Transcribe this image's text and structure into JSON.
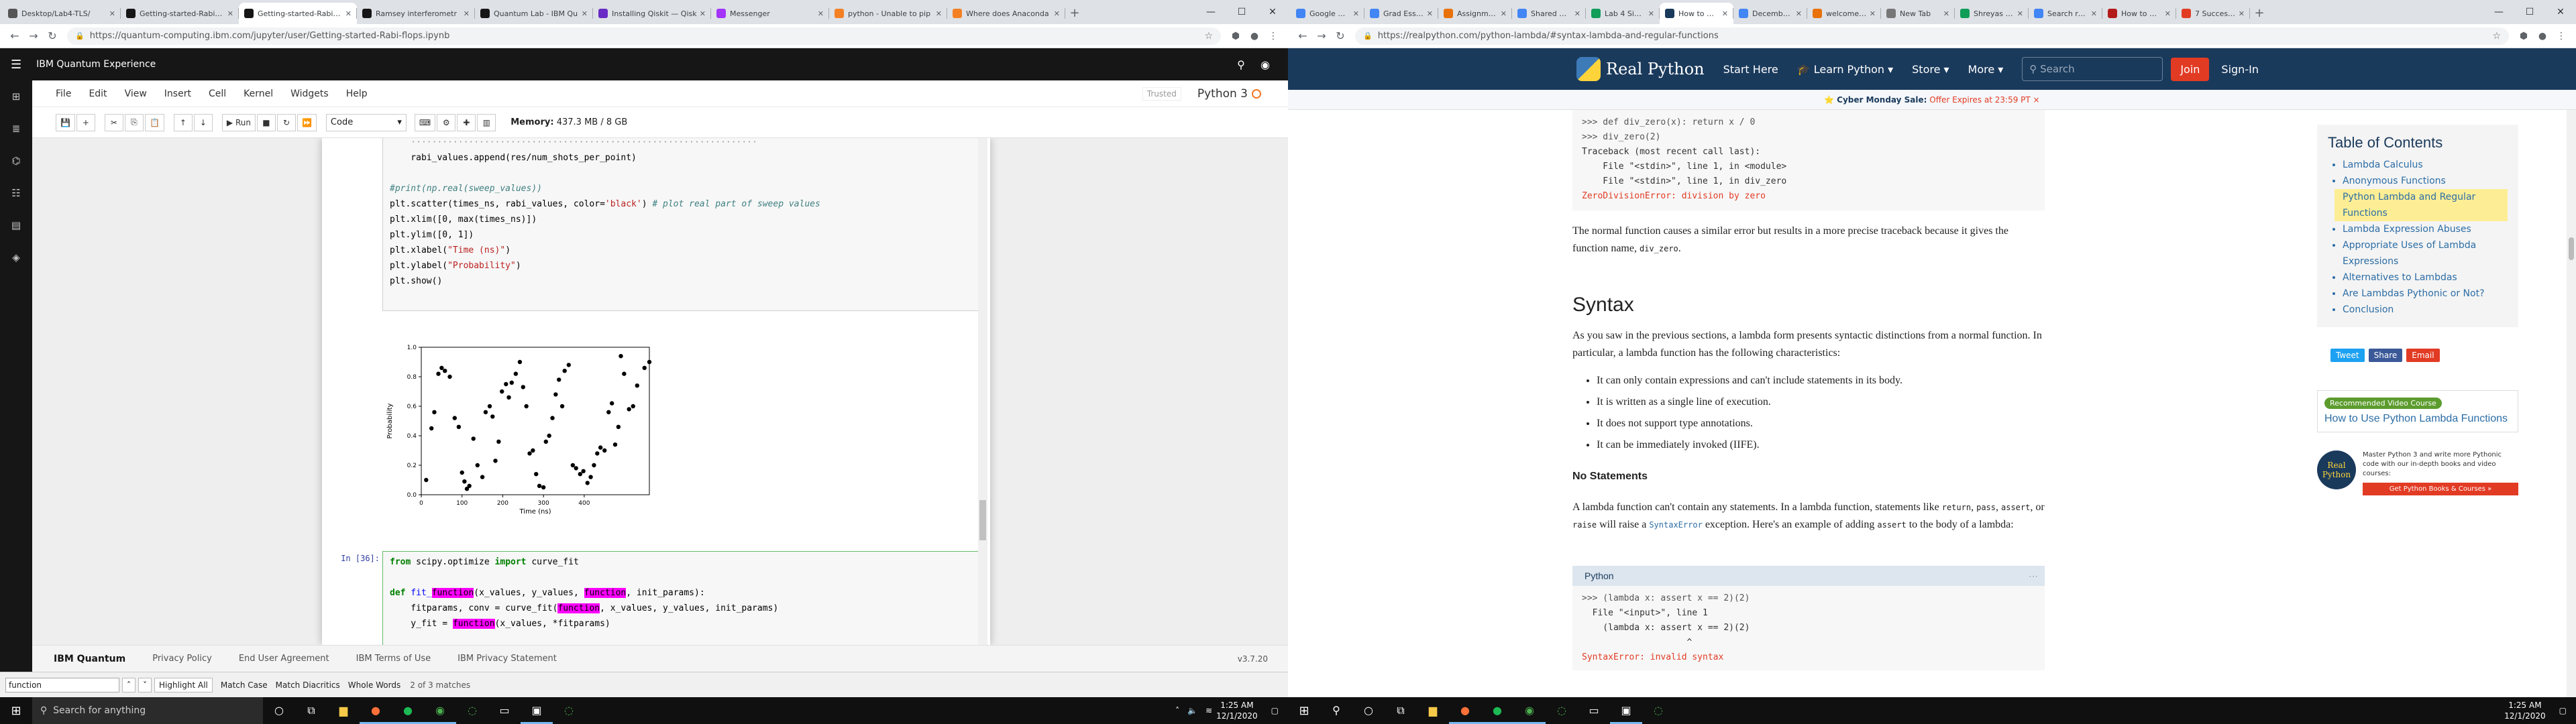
{
  "left_browser": {
    "tabs": [
      {
        "title": "Desktop/Lab4-TLS/",
        "fav_color": "#555555"
      },
      {
        "title": "Getting-started-Rabi-flo",
        "fav_color": "#161616"
      },
      {
        "title": "Getting-started-Rabi-flo",
        "fav_color": "#161616"
      },
      {
        "title": "Ramsey interferometr",
        "fav_color": "#161616"
      },
      {
        "title": "Quantum Lab - IBM Qu",
        "fav_color": "#161616"
      },
      {
        "title": "Installing Qiskit — Qisk",
        "fav_color": "#6929c4"
      },
      {
        "title": "Messenger",
        "fav_color": "#a334fa"
      },
      {
        "title": "python - Unable to pip",
        "fav_color": "#f48024"
      },
      {
        "title": "Where does Anaconda",
        "fav_color": "#f48024"
      }
    ],
    "url": "https://quantum-computing.ibm.com/jupyter/user/Getting-started-Rabi-flops.ipynb"
  },
  "ibm": {
    "brand": "IBM Quantum Experience",
    "menu": [
      "File",
      "Edit",
      "View",
      "Insert",
      "Cell",
      "Kernel",
      "Widgets",
      "Help"
    ],
    "trusted": "Trusted",
    "kernel": "Python 3",
    "toolbar": {
      "run": "Run",
      "cell_type": "Code",
      "memory_label": "Memory:",
      "memory_value": "437.3 MB / 8 GB"
    },
    "code1": {
      "line_prev": "    rabi_values.append(res/num_shots_per_point)",
      "comment": "#print(np.real(sweep_values))",
      "scatter_a": "plt.scatter(times_ns, rabi_values, color=",
      "scatter_b": "'black'",
      "scatter_c": ") ",
      "scatter_comment": "# plot real part of sweep values",
      "xlim": "plt.xlim([0, max(times_ns)])",
      "ylim": "plt.ylim([0, 1])",
      "xlabel_a": "plt.xlabel(",
      "xlabel_b": "\"Time (ns)\"",
      "xlabel_c": ")",
      "ylabel_a": "plt.ylabel(",
      "ylabel_b": "\"Probability\"",
      "ylabel_c": ")",
      "show": "plt.show()"
    },
    "code2": {
      "prompt": "In [36]:",
      "l1a": "from",
      "l1b": " scipy.optimize ",
      "l1c": "import",
      "l1d": " curve_fit",
      "l2a": "def",
      "l2b": " fit_",
      "l2c": "function",
      "l2d": "(x_values, y_values, ",
      "l2e": "function",
      "l2f": ", init_params):",
      "l3a": "    fitparams, conv = curve_fit(",
      "l3b": "function",
      "l3c": ", x_values, y_values, init_params)",
      "l4a": "    y_fit = ",
      "l4b": "function",
      "l4c": "(x_values, *fitparams)"
    },
    "footer": {
      "brand": "IBM Quantum",
      "links": [
        "Privacy Policy",
        "End User Agreement",
        "IBM Terms of Use",
        "IBM Privacy Statement"
      ],
      "version": "v3.7.20"
    },
    "find": {
      "query": "function",
      "highlight": "Highlight All",
      "match_case": "Match Case",
      "match_diacritics": "Match Diacritics",
      "whole_words": "Whole Words",
      "result": "2 of 3 matches"
    }
  },
  "chart_data": {
    "type": "scatter",
    "xlabel": "Time (ns)",
    "ylabel": "Probability",
    "xlim": [
      0,
      490
    ],
    "ylim": [
      0,
      1
    ],
    "xticks": [
      0,
      100,
      200,
      300,
      400
    ],
    "yticks": [
      0.0,
      0.2,
      0.4,
      0.6,
      0.8,
      1.0
    ],
    "points": [
      [
        12,
        0.1
      ],
      [
        25,
        0.45
      ],
      [
        32,
        0.56
      ],
      [
        42,
        0.82
      ],
      [
        50,
        0.86
      ],
      [
        58,
        0.84
      ],
      [
        70,
        0.8
      ],
      [
        82,
        0.52
      ],
      [
        92,
        0.46
      ],
      [
        100,
        0.15
      ],
      [
        106,
        0.09
      ],
      [
        112,
        0.04
      ],
      [
        118,
        0.06
      ],
      [
        128,
        0.38
      ],
      [
        138,
        0.2
      ],
      [
        150,
        0.12
      ],
      [
        158,
        0.56
      ],
      [
        168,
        0.6
      ],
      [
        175,
        0.53
      ],
      [
        182,
        0.23
      ],
      [
        190,
        0.36
      ],
      [
        198,
        0.7
      ],
      [
        208,
        0.75
      ],
      [
        215,
        0.66
      ],
      [
        222,
        0.76
      ],
      [
        232,
        0.82
      ],
      [
        242,
        0.9
      ],
      [
        250,
        0.73
      ],
      [
        258,
        0.6
      ],
      [
        266,
        0.28
      ],
      [
        274,
        0.3
      ],
      [
        282,
        0.14
      ],
      [
        290,
        0.06
      ],
      [
        300,
        0.05
      ],
      [
        306,
        0.36
      ],
      [
        314,
        0.4
      ],
      [
        322,
        0.52
      ],
      [
        330,
        0.68
      ],
      [
        338,
        0.78
      ],
      [
        346,
        0.6
      ],
      [
        352,
        0.84
      ],
      [
        362,
        0.88
      ],
      [
        372,
        0.2
      ],
      [
        380,
        0.18
      ],
      [
        390,
        0.14
      ],
      [
        398,
        0.16
      ],
      [
        408,
        0.08
      ],
      [
        416,
        0.12
      ],
      [
        424,
        0.2
      ],
      [
        432,
        0.28
      ],
      [
        440,
        0.32
      ],
      [
        450,
        0.3
      ],
      [
        460,
        0.56
      ],
      [
        468,
        0.62
      ],
      [
        476,
        0.34
      ],
      [
        484,
        0.46
      ],
      [
        490,
        0.94
      ],
      [
        498,
        0.82
      ],
      [
        510,
        0.58
      ],
      [
        520,
        0.6
      ],
      [
        530,
        0.74
      ],
      [
        548,
        0.86
      ],
      [
        560,
        0.9
      ]
    ]
  },
  "right_browser": {
    "tabs": [
      {
        "title": "Google Docs",
        "fav_color": "#4285f4"
      },
      {
        "title": "Grad Essays",
        "fav_color": "#4285f4"
      },
      {
        "title": "Assignments",
        "fav_color": "#e8710a"
      },
      {
        "title": "Shared with",
        "fav_color": "#4285f4"
      },
      {
        "title": "Lab 4 Signal",
        "fav_color": "#0f9d58"
      },
      {
        "title": "How to Use",
        "fav_color": "#1a3a5c"
      },
      {
        "title": "December 1",
        "fav_color": "#4285f4"
      },
      {
        "title": "welcome | L",
        "fav_color": "#e8710a"
      },
      {
        "title": "New Tab",
        "fav_color": "#777777"
      },
      {
        "title": "Shreyas Vasu",
        "fav_color": "#0f9d58"
      },
      {
        "title": "Search results",
        "fav_color": "#4285f4"
      },
      {
        "title": "How to Write",
        "fav_color": "#b31b1b"
      },
      {
        "title": "7 Successful",
        "fav_color": "#e23b24"
      }
    ],
    "url": "https://realpython.com/python-lambda/#syntax-lambda-and-regular-functions"
  },
  "rp": {
    "logo": "Real Python",
    "nav": [
      "Start Here",
      "Learn Python ▾",
      "Store ▾",
      "More ▾"
    ],
    "search_placeholder": "Search",
    "join": "Join",
    "signin": "Sign-In",
    "banner_a": "Cyber Monday Sale:",
    "banner_b": "Offer Expires at 23:59 PT ×",
    "code1": {
      "l1": ">>> def div_zero(x): return x / 0",
      "l2": ">>> div_zero(2)",
      "l3": "Traceback (most recent call last):",
      "l4": "    File \"<stdin>\", line 1, in <module>",
      "l5": "    File \"<stdin>\", line 1, in div_zero",
      "l6": "ZeroDivisionError: division by zero"
    },
    "para1_a": "The normal function causes a similar error but results in a more precise traceback because it gives the function name, ",
    "para1_code": "div_zero",
    "para1_b": ".",
    "h2": "Syntax",
    "para2": "As you saw in the previous sections, a lambda form presents syntactic distinctions from a normal function. In particular, a lambda function has the following characteristics:",
    "bullets": [
      "It can only contain expressions and can't include statements in its body.",
      "It is written as a single line of execution.",
      "It does not support type annotations.",
      "It can be immediately invoked (IIFE)."
    ],
    "h3": "No Statements",
    "para3_a": "A lambda function can't contain any statements. In a lambda function, statements like ",
    "para3_c1": "return",
    "para3_s1": ", ",
    "para3_c2": "pass",
    "para3_s2": ", ",
    "para3_c3": "assert",
    "para3_s3": ", or ",
    "para3_c4": "raise",
    "para3_b": " will raise a ",
    "para3_link": "SyntaxError",
    "para3_c": " exception. Here's an example of adding ",
    "para3_c5": "assert",
    "para3_d": " to the body of a lambda:",
    "code2_header": "Python",
    "code2": {
      "l1": ">>> (lambda x: assert x == 2)(2)",
      "l2": "  File \"<input>\", line 1",
      "l3": "    (lambda x: assert x == 2)(2)",
      "l4": "                    ^",
      "l5": "SyntaxError: invalid syntax"
    },
    "toc_title": "Table of Contents",
    "toc": [
      "Lambda Calculus",
      "Anonymous Functions",
      "Python Lambda and Regular Functions",
      "Lambda Expression Abuses",
      "Appropriate Uses of Lambda Expressions",
      "Alternatives to Lambdas",
      "Are Lambdas Pythonic or Not?",
      "Conclusion"
    ],
    "share": [
      {
        "label": "Tweet",
        "color": "#1da1f2"
      },
      {
        "label": "Share",
        "color": "#3b5998"
      },
      {
        "label": "Email",
        "color": "#e23b24"
      }
    ],
    "course_badge": "Recommended Video Course",
    "course_title": "How to Use Python Lambda Functions",
    "promo_logo": "Real Python",
    "promo_text": "Master Python 3 and write more Pythonic code with our in-depth books and video courses:",
    "promo_btn": "Get Python Books & Courses »"
  },
  "taskbar": {
    "search": "Search for anything",
    "time": "1:25 AM",
    "date": "12/1/2020"
  }
}
